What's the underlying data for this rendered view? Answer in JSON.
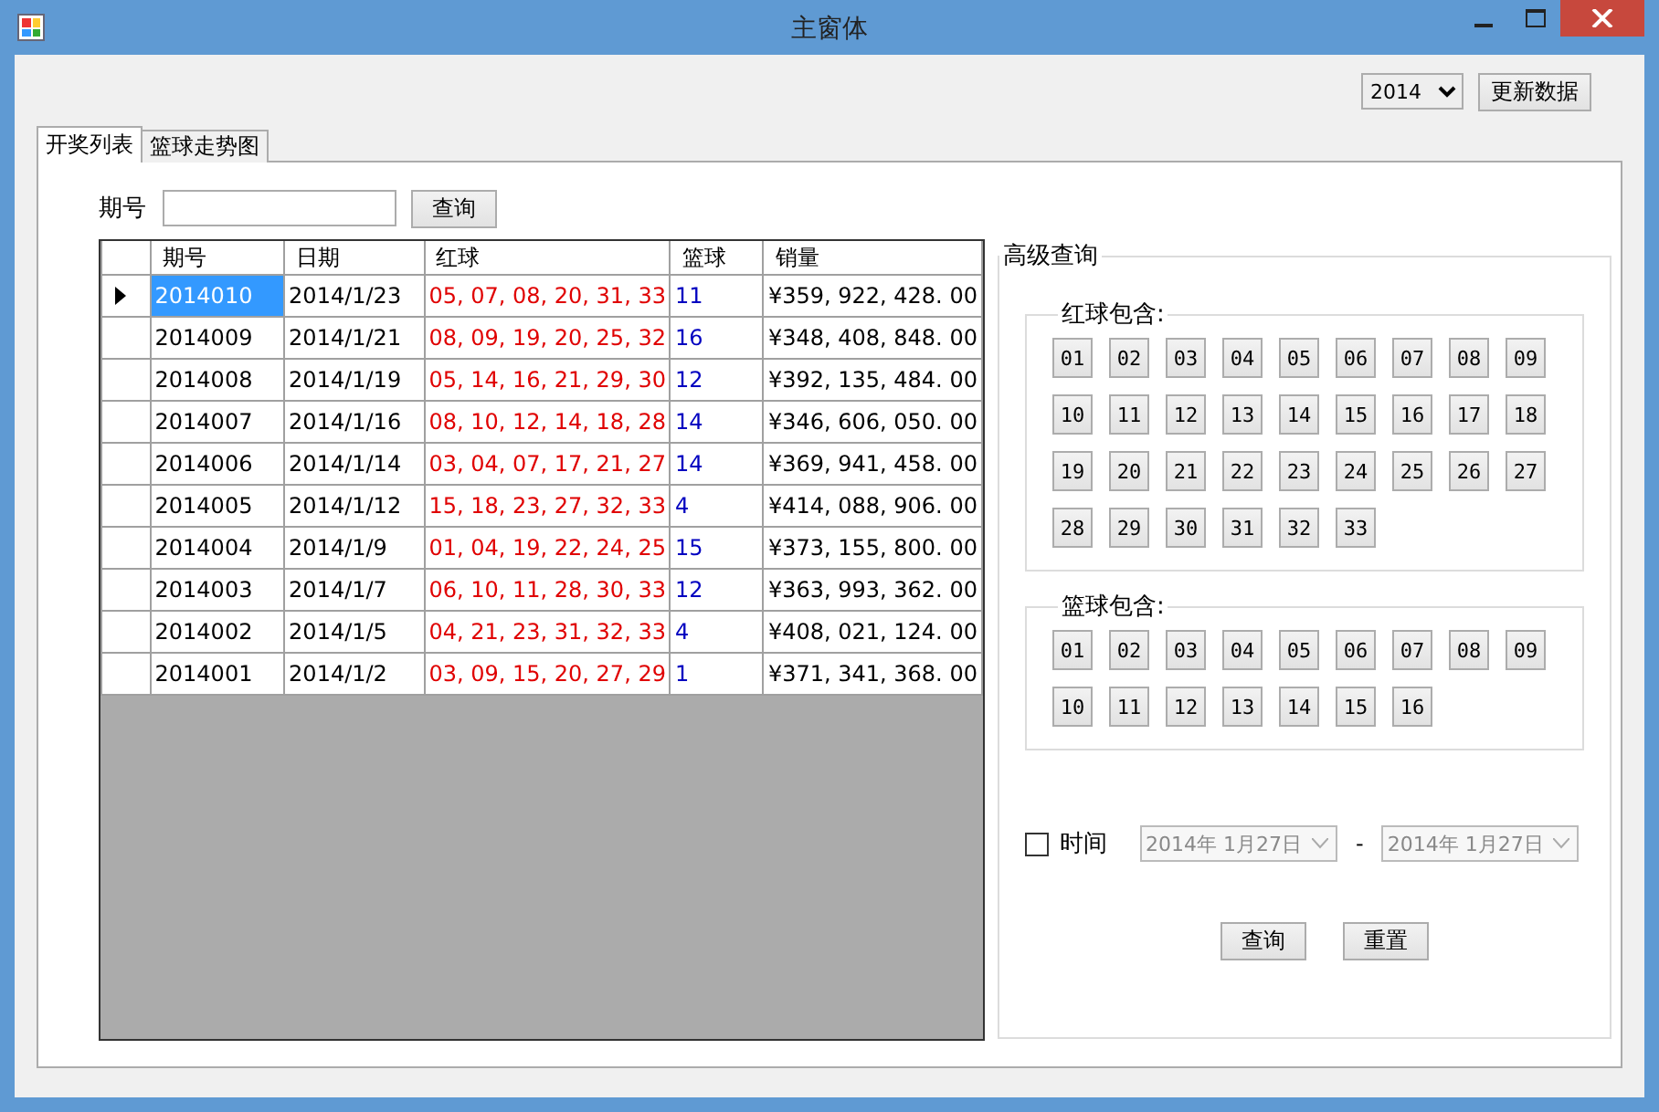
{
  "window": {
    "title": "主窗体"
  },
  "toolbar": {
    "year": "2014",
    "update_button": "更新数据"
  },
  "tabs": [
    {
      "label": "开奖列表",
      "selected": true
    },
    {
      "label": "篮球走势图",
      "selected": false
    }
  ],
  "search": {
    "label": "期号",
    "button": "查询"
  },
  "table": {
    "columns": [
      "期号",
      "日期",
      "红球",
      "篮球",
      "销量"
    ],
    "rows": [
      {
        "issue": "2014010",
        "date": "2014/1/23",
        "red": "05, 07, 08, 20, 31, 33",
        "blue": "11",
        "sales": "¥359, 922, 428. 00",
        "selected": true
      },
      {
        "issue": "2014009",
        "date": "2014/1/21",
        "red": "08, 09, 19, 20, 25, 32",
        "blue": "16",
        "sales": "¥348, 408, 848. 00",
        "selected": false
      },
      {
        "issue": "2014008",
        "date": "2014/1/19",
        "red": "05, 14, 16, 21, 29, 30",
        "blue": "12",
        "sales": "¥392, 135, 484. 00",
        "selected": false
      },
      {
        "issue": "2014007",
        "date": "2014/1/16",
        "red": "08, 10, 12, 14, 18, 28",
        "blue": "14",
        "sales": "¥346, 606, 050. 00",
        "selected": false
      },
      {
        "issue": "2014006",
        "date": "2014/1/14",
        "red": "03, 04, 07, 17, 21, 27",
        "blue": "14",
        "sales": "¥369, 941, 458. 00",
        "selected": false
      },
      {
        "issue": "2014005",
        "date": "2014/1/12",
        "red": "15, 18, 23, 27, 32, 33",
        "blue": "4",
        "sales": "¥414, 088, 906. 00",
        "selected": false
      },
      {
        "issue": "2014004",
        "date": "2014/1/9",
        "red": "01, 04, 19, 22, 24, 25",
        "blue": "15",
        "sales": "¥373, 155, 800. 00",
        "selected": false
      },
      {
        "issue": "2014003",
        "date": "2014/1/7",
        "red": "06, 10, 11, 28, 30, 33",
        "blue": "12",
        "sales": "¥363, 993, 362. 00",
        "selected": false
      },
      {
        "issue": "2014002",
        "date": "2014/1/5",
        "red": "04, 21, 23, 31, 32, 33",
        "blue": "4",
        "sales": "¥408, 021, 124. 00",
        "selected": false
      },
      {
        "issue": "2014001",
        "date": "2014/1/2",
        "red": "03, 09, 15, 20, 27, 29",
        "blue": "1",
        "sales": "¥371, 341, 368. 00",
        "selected": false
      }
    ]
  },
  "advanced": {
    "title": "高级查询",
    "groups": [
      {
        "title": "红球包含:",
        "balls": [
          "01",
          "02",
          "03",
          "04",
          "05",
          "06",
          "07",
          "08",
          "09",
          "10",
          "11",
          "12",
          "13",
          "14",
          "15",
          "16",
          "17",
          "18",
          "19",
          "20",
          "21",
          "22",
          "23",
          "24",
          "25",
          "26",
          "27",
          "28",
          "29",
          "30",
          "31",
          "32",
          "33"
        ]
      },
      {
        "title": "篮球包含:",
        "balls": [
          "01",
          "02",
          "03",
          "04",
          "05",
          "06",
          "07",
          "08",
          "09",
          "10",
          "11",
          "12",
          "13",
          "14",
          "15",
          "16"
        ]
      }
    ],
    "time": {
      "label": "时间",
      "checked": false,
      "from": "2014年  1月27日",
      "separator": "-",
      "to": "2014年  1月27日",
      "disabled": true
    },
    "buttons": [
      "查询",
      "重置"
    ]
  }
}
